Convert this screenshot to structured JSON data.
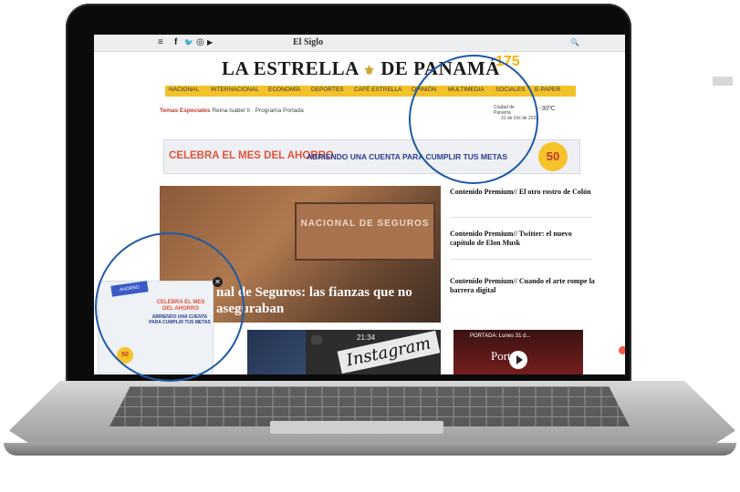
{
  "topbar": {
    "menu_icon": "≡",
    "facebook": "f",
    "twitter": "🐦",
    "instagram": "◎",
    "youtube": "▶",
    "brand_link": "El Siglo",
    "search_icon": "🔍"
  },
  "logo": {
    "left": "LA ESTRELLA",
    "right": "DE PANAMÁ",
    "badge": "175"
  },
  "nav": [
    "NACIONAL",
    "INTERNACIONAL",
    "ECONOMÍA",
    "DEPORTES",
    "CAFÉ ESTRELLA",
    "OPINIÓN",
    "MULTIMEDIA",
    "SOCIALES",
    "E-PAPER"
  ],
  "temas": {
    "label": "Temas Especiales",
    "links": "Reina Isabel II · Programa Portada"
  },
  "weather": {
    "city": "Ciudad de Panamá",
    "temp": "-30ºC",
    "date": "31 de Oct de 2022"
  },
  "ad": {
    "headline": "CELEBRA EL MES DEL AHORRO",
    "sub": "ABRIENDO UNA CUENTA PARA CUMPLIR TUS METAS",
    "badge": "50"
  },
  "hero": {
    "sign": "NACIONAL DE SEGUROS",
    "title": "nal de Seguros: las fianzas que no aseguraban"
  },
  "side_stories": [
    "Contenido Premium// El otro rostro de Colón",
    "Contenido Premium// Twitter: el nuevo capítulo de Elon Musk",
    "Contenido Premium// Cuando el arte rompe la barrera digital"
  ],
  "thumbs": {
    "instagram": "Instagram",
    "time": "21:34",
    "yt_title": "PORTADA: Lunes 31 d...",
    "yt_portada": "Portada"
  },
  "popup": {
    "banner": "AHORRO",
    "line1": "CELEBRA EL MES DEL AHORRO",
    "line2": "ABRIENDO UNA CUENTA PARA CUMPLIR TUS METAS",
    "badge": "50",
    "close": "✕"
  },
  "colors": {
    "nav_bg": "#f3c22a",
    "accent_red": "#e0533a",
    "accent_blue": "#2a3d8f",
    "circle": "#1e5aa6"
  }
}
